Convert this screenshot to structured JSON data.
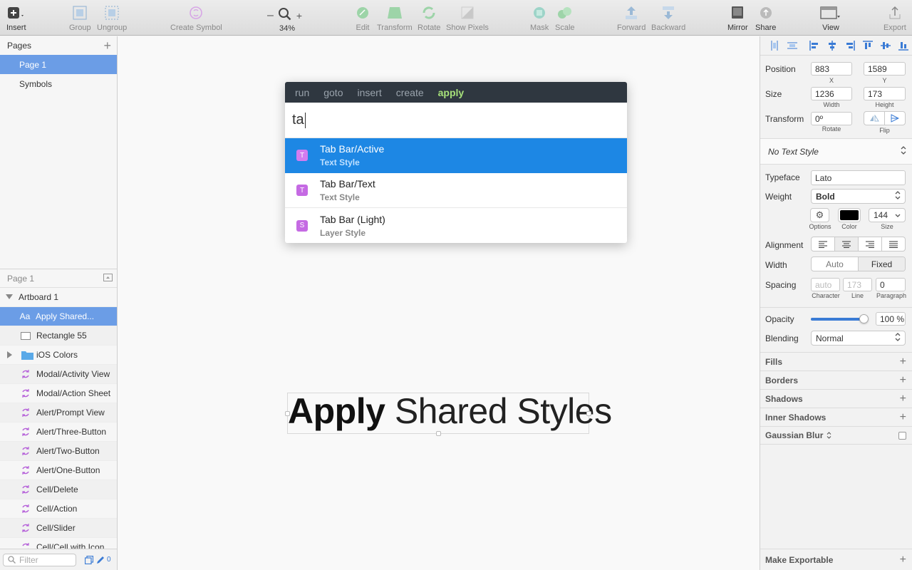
{
  "toolbar": {
    "insert": "Insert",
    "group": "Group",
    "ungroup": "Ungroup",
    "create_symbol": "Create Symbol",
    "zoom_minus": "–",
    "zoom_plus": "+",
    "zoom_level": "34%",
    "edit": "Edit",
    "transform": "Transform",
    "rotate": "Rotate",
    "show_pixels": "Show Pixels",
    "mask": "Mask",
    "scale": "Scale",
    "forward": "Forward",
    "backward": "Backward",
    "mirror": "Mirror",
    "share": "Share",
    "view": "View",
    "export": "Export"
  },
  "pages": {
    "header": "Pages",
    "items": [
      "Page 1",
      "Symbols"
    ]
  },
  "layers": {
    "header": "Page 1",
    "artboard": "Artboard 1",
    "items": [
      {
        "label": "Apply Shared...",
        "icon": "text-icon"
      },
      {
        "label": "Rectangle 55",
        "icon": "rectangle-icon"
      },
      {
        "label": "iOS Colors",
        "icon": "folder-icon"
      },
      {
        "label": "Modal/Activity View",
        "icon": "symbol-icon"
      },
      {
        "label": "Modal/Action Sheet",
        "icon": "symbol-icon"
      },
      {
        "label": "Alert/Prompt View",
        "icon": "symbol-icon"
      },
      {
        "label": "Alert/Three-Button",
        "icon": "symbol-icon"
      },
      {
        "label": "Alert/Two-Button",
        "icon": "symbol-icon"
      },
      {
        "label": "Alert/One-Button",
        "icon": "symbol-icon"
      },
      {
        "label": "Cell/Delete",
        "icon": "symbol-icon"
      },
      {
        "label": "Cell/Action",
        "icon": "symbol-icon"
      },
      {
        "label": "Cell/Slider",
        "icon": "symbol-icon"
      },
      {
        "label": "Cell/Cell with Icon",
        "icon": "symbol-icon"
      }
    ],
    "filter_placeholder": "Filter",
    "edit_count": "0"
  },
  "runner": {
    "tabs": [
      "run",
      "goto",
      "insert",
      "create",
      "apply"
    ],
    "active_tab": "apply",
    "query": "ta",
    "results": [
      {
        "badge": "T",
        "title": "Tab Bar/Active",
        "subtitle": "Text Style"
      },
      {
        "badge": "T",
        "title": "Tab Bar/Text",
        "subtitle": "Text Style"
      },
      {
        "badge": "S",
        "title": "Tab Bar (Light)",
        "subtitle": "Layer Style"
      }
    ]
  },
  "canvas": {
    "text_bold": "Apply",
    "text_light": "Shared Styles"
  },
  "inspector": {
    "position_label": "Position",
    "x": "883",
    "y": "1589",
    "x_label": "X",
    "y_label": "Y",
    "size_label": "Size",
    "width": "1236",
    "height": "173",
    "width_label": "Width",
    "height_label": "Height",
    "transform_label": "Transform",
    "rotate": "0º",
    "rotate_label": "Rotate",
    "flip_label": "Flip",
    "text_style": "No Text Style",
    "typeface_label": "Typeface",
    "typeface": "Lato",
    "weight_label": "Weight",
    "weight": "Bold",
    "options_label": "Options",
    "color_label": "Color",
    "size_value": "144",
    "size_sub": "Size",
    "alignment_label": "Alignment",
    "width_mode_label": "Width",
    "width_auto": "Auto",
    "width_fixed": "Fixed",
    "spacing_label": "Spacing",
    "character_ph": "auto",
    "line_ph": "173",
    "paragraph": "0",
    "character_label": "Character",
    "line_label": "Line",
    "paragraph_label": "Paragraph",
    "opacity_label": "Opacity",
    "opacity_value": "100 %",
    "opacity_fraction": 1.0,
    "blending_label": "Blending",
    "blending": "Normal",
    "sections": [
      "Fills",
      "Borders",
      "Shadows",
      "Inner Shadows",
      "Gaussian Blur"
    ],
    "make_exportable": "Make Exportable"
  },
  "colors": {
    "selection": "#6b9de6",
    "runner_highlight": "#1d87e4",
    "runner_header": "#2f3740",
    "apply_green": "#a6e07a",
    "style_badge": "#c56ae3"
  }
}
